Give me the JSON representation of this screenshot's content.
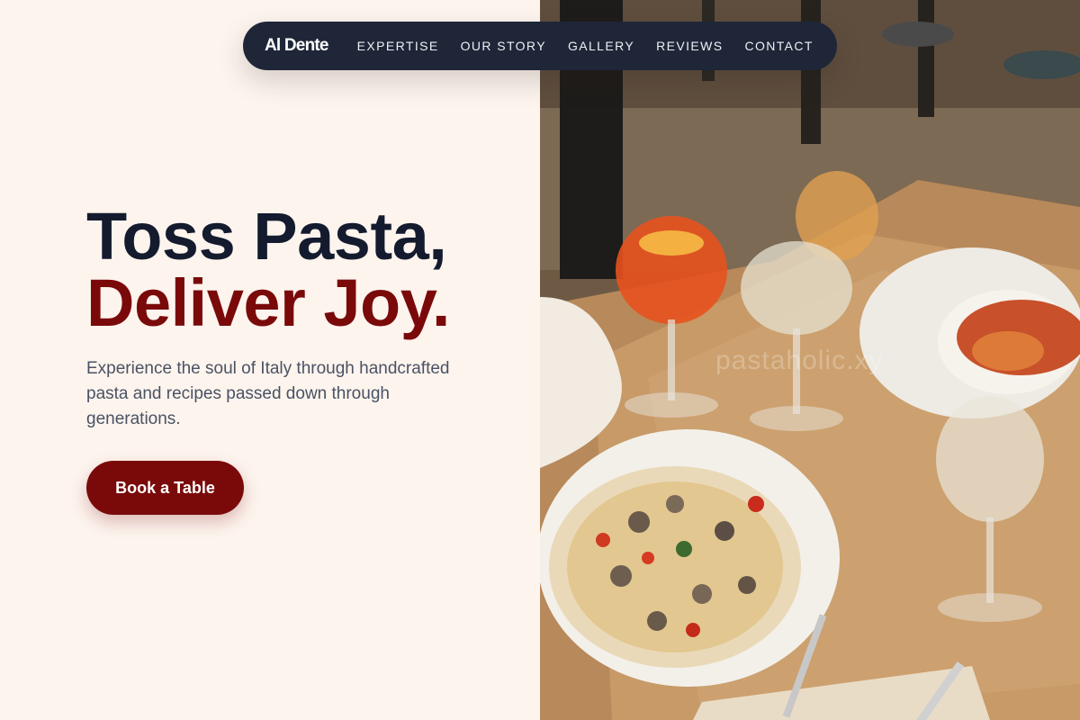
{
  "nav": {
    "brand": "Al Dente",
    "links": [
      "EXPERTISE",
      "OUR STORY",
      "GALLERY",
      "REVIEWS",
      "CONTACT"
    ]
  },
  "hero": {
    "headline_line1": "Toss Pasta,",
    "headline_line2": "Deliver Joy.",
    "subtitle": "Experience the soul of Italy through handcrafted pasta and recipes passed down through generations.",
    "cta_label": "Book a Table",
    "photo_watermark": "pastaholic.xy"
  },
  "colors": {
    "background": "#fdf4ee",
    "navbar": "#1e2638",
    "heading_dark": "#141b2e",
    "accent_red": "#7a0a0a",
    "body_text": "#4a5264"
  }
}
